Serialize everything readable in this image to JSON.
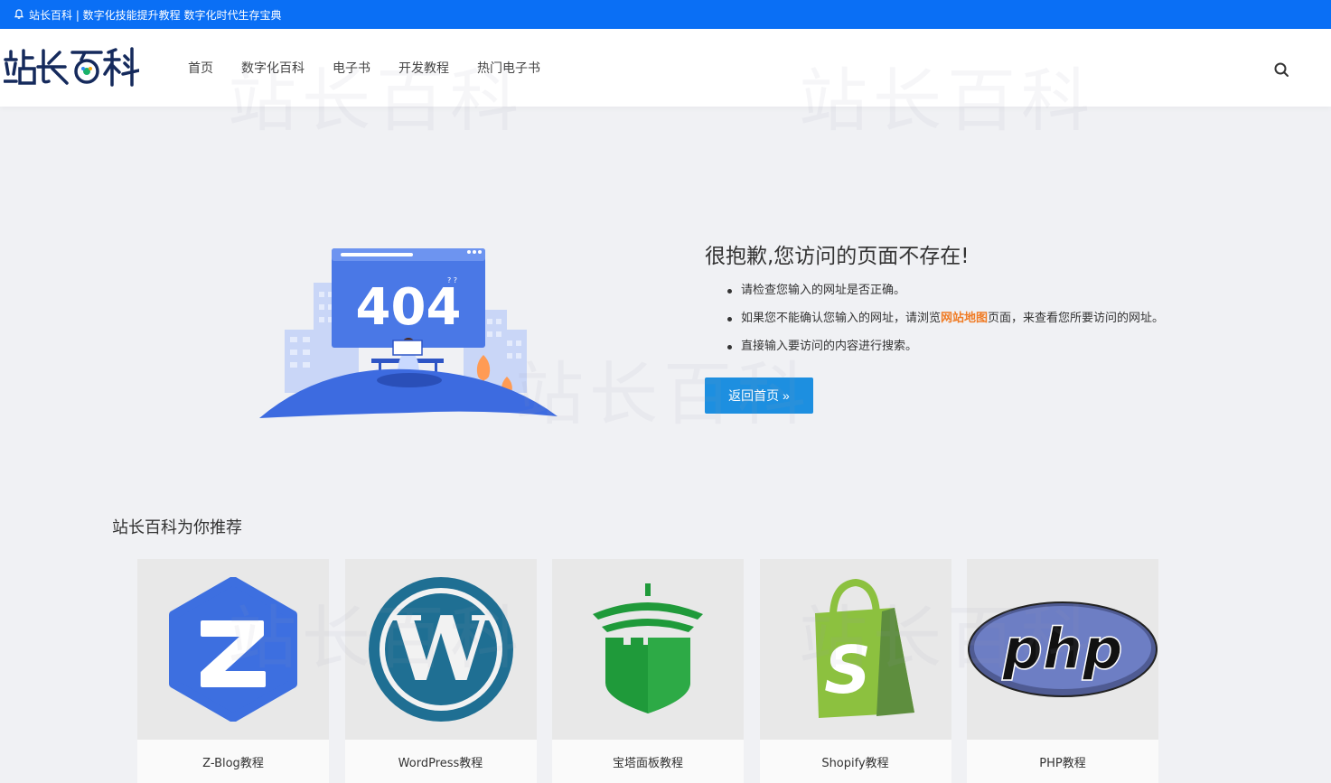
{
  "notice": {
    "text": "站长百科 | 数字化技能提升教程 数字化时代生存宝典"
  },
  "header": {
    "logo_text": "站长百科",
    "nav": [
      "首页",
      "数字化百科",
      "电子书",
      "开发教程",
      "热门电子书"
    ]
  },
  "watermark": "站长百科",
  "error": {
    "code": "404",
    "title": "很抱歉,您访问的页面不存在!",
    "tip1": "请检查您输入的网址是否正确。",
    "tip2_before": "如果您不能确认您输入的网址，请浏览",
    "tip2_link": "网站地图",
    "tip2_after": "页面，来查看您所要访问的网址。",
    "tip3": "直接输入要访问的内容进行搜索。",
    "back_label": "返回首页 »"
  },
  "recommend": {
    "title": "站长百科为你推荐",
    "items": [
      {
        "label": "Z-Blog教程",
        "icon": "zblog-logo"
      },
      {
        "label": "WordPress教程",
        "icon": "wordpress-logo"
      },
      {
        "label": "宝塔面板教程",
        "icon": "baota-logo"
      },
      {
        "label": "Shopify教程",
        "icon": "shopify-logo"
      },
      {
        "label": "PHP教程",
        "icon": "php-logo"
      }
    ]
  },
  "colors": {
    "topbar": "#0a6ff5",
    "button": "#1d8fe0",
    "link": "#f07b24",
    "background": "#f0f1f4"
  }
}
